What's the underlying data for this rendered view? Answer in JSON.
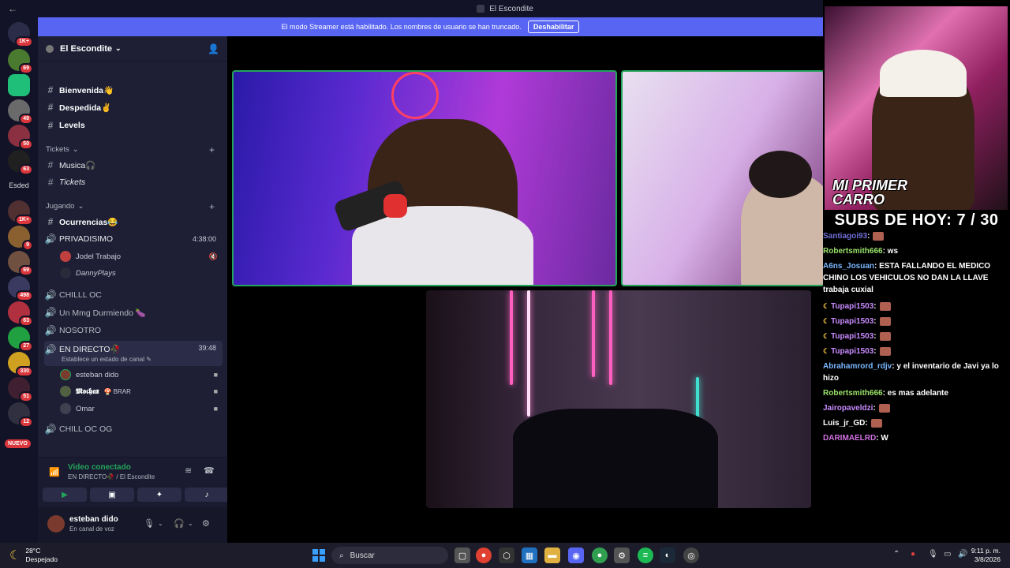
{
  "window": {
    "title": "El Escondite"
  },
  "streamer_banner": {
    "text": "El modo Streamer está habilitado. Los nombres de usuario se han truncado.",
    "button": "Deshabilitar"
  },
  "server_bar": {
    "badges": [
      "1K+",
      "69",
      "49",
      "50",
      "63",
      "1K+",
      "9",
      "69",
      "498",
      "63",
      "27",
      "330",
      "51",
      "12"
    ],
    "text_item": "Esded",
    "new_label": "NUEVO"
  },
  "server": {
    "name": "El Escondite"
  },
  "channels": {
    "top": [
      {
        "name": "Bienvenida👋",
        "type": "text",
        "bold": true
      },
      {
        "name": "Despedida✌",
        "type": "text",
        "bold": true
      },
      {
        "name": "Levels",
        "type": "text",
        "bold": true
      }
    ],
    "cat_tickets": "Tickets",
    "tickets": [
      {
        "name": "Musica🎧",
        "type": "text"
      },
      {
        "name": "Tickets",
        "type": "text"
      }
    ],
    "cat_jugando": "Jugando",
    "jugando": {
      "ocurrencias": "Ocurrencias😂",
      "privadisimo": {
        "name": "PRIVADISIMO",
        "time": "4:38:00"
      },
      "privadisimo_users": [
        "Jodel Trabajo",
        "DannyPlays"
      ],
      "chilll": "CHILLL OC",
      "mmg": "Un Mmg Durmiendo 🍆",
      "nosotro": "NOSOTRO",
      "directo": {
        "name": "EN DIRECTO🥀",
        "time": "39:48",
        "status": "Establece un estado de canal"
      },
      "directo_users": [
        "esteban dido",
        "𝕸𝖔𝖈𝖍𝖆𝖝",
        "Omar"
      ],
      "mochax_tag": "🍄 BRAR",
      "chill_og": "CHILL OC OG"
    }
  },
  "voice_panel": {
    "title": "Video conectado",
    "subtitle": "EN DIRECTO🥀 / El Escondite"
  },
  "user_panel": {
    "name": "esteban dido",
    "status": "En canal de voz"
  },
  "overlay": {
    "cam_title_1": "MI PRIMER",
    "cam_title_2": "CARRO",
    "subs": "SUBS DE HOY: 7 / 30",
    "chat": [
      {
        "user": "Santiagoi93",
        "text": ":",
        "color": "#6f6fd8",
        "icon": ""
      },
      {
        "user": "Robertsmith666",
        "text": ": ws",
        "color": "#9be36a",
        "icon": ""
      },
      {
        "user": "A6ns_Josuan",
        "text": ": ESTA FALLANDO EL MEDICO CHINO LOS VEHICULOS NO DAN LA LLAVE trabaja cuxial",
        "color": "#7ab8ff",
        "icon": ""
      },
      {
        "user": "Tupapi1503",
        "text": ":",
        "color": "#c88bff",
        "icon": "☾"
      },
      {
        "user": "Tupapi1503",
        "text": ":",
        "color": "#c88bff",
        "icon": "☾"
      },
      {
        "user": "Tupapi1503",
        "text": ":",
        "color": "#c88bff",
        "icon": "☾"
      },
      {
        "user": "Tupapi1503",
        "text": ":",
        "color": "#c88bff",
        "icon": "☾"
      },
      {
        "user": "Abrahamrord_rdjv",
        "text": ": y el inventario de Javi ya lo hizo",
        "color": "#7ab8ff",
        "icon": ""
      },
      {
        "user": "Robertsmith666",
        "text": ": es mas adelante",
        "color": "#9be36a",
        "icon": ""
      },
      {
        "user": "Jairopaveldzi",
        "text": ":",
        "color": "#c88bff",
        "icon": ""
      },
      {
        "user": "Luis_jr_GD",
        "text": ":",
        "color": "#ffffff",
        "icon": ""
      },
      {
        "user": "DARIMAELRD",
        "text": ": W",
        "color": "#d070e0",
        "icon": ""
      }
    ]
  },
  "taskbar": {
    "temp": "28°C",
    "weather": "Despejado",
    "search": "Buscar",
    "time": "9:11 p. m.",
    "date": "3/8/2026"
  }
}
